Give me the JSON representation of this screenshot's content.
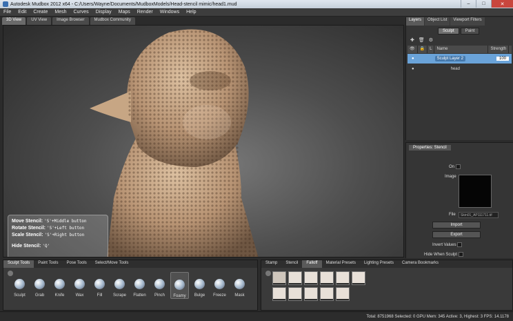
{
  "window": {
    "title": "Autodesk Mudbox 2012 x64 - C:/Users/Wayne/Documents/MudboxModels/Head-stencil mimic/head1.mud",
    "min": "–",
    "max": "□",
    "close": "✕"
  },
  "menu": [
    "File",
    "Edit",
    "Create",
    "Mesh",
    "Curves",
    "Display",
    "Maps",
    "Render",
    "Windows",
    "Help"
  ],
  "view_tabs": [
    "3D View",
    "UV View",
    "Image Browser",
    "Mudbox Community"
  ],
  "stencil_help": {
    "move": {
      "label": "Move Stencil:",
      "keys": "'S'+Middle button"
    },
    "rotate": {
      "label": "Rotate Stencil:",
      "keys": "'S'+Left button"
    },
    "scale": {
      "label": "Scale Stencil:",
      "keys": "'S'+Right button"
    },
    "hide": {
      "label": "Hide Stencil:",
      "keys": "'Q'"
    }
  },
  "right_tabs": [
    "Layers",
    "Object List",
    "Viewport Filters"
  ],
  "layers": {
    "mode_tabs": [
      "Sculpt",
      "Paint"
    ],
    "columns": [
      "L",
      "Name",
      "Strength"
    ],
    "rows": [
      {
        "name": "Sculpt Layer 2",
        "strength": "100",
        "selected": true
      },
      {
        "name": "head",
        "strength": "",
        "selected": false
      }
    ]
  },
  "properties": {
    "title": "Properties: Stencil",
    "on_label": "On",
    "image_label": "Image",
    "file_label": "File",
    "file_value": "Skin01_AP111711.tif",
    "import": "Import",
    "export": "Export",
    "invert_values": "Invert Values",
    "hide_when_sculpt": "Hide When Sculpt"
  },
  "bottom_left_tabs": [
    "Sculpt Tools",
    "Paint Tools",
    "Pose Tools",
    "Select/Move Tools"
  ],
  "tools": [
    "Sculpt",
    "Grab",
    "Knife",
    "Wax",
    "Fill",
    "Scrape",
    "Flatten",
    "Pinch",
    "Foamy",
    "Bulge",
    "Freeze",
    "Mask"
  ],
  "active_tool": "Foamy",
  "bottom_right_tabs": [
    "Stamp",
    "Stencil",
    "Falloff",
    "Material Presets",
    "Lighting Presets",
    "Camera Bookmarks"
  ],
  "status": "Total: 8751968  Selected: 0  GPU Mem: 345  Active: 3, Highest: 3  FPS: 14.1178"
}
